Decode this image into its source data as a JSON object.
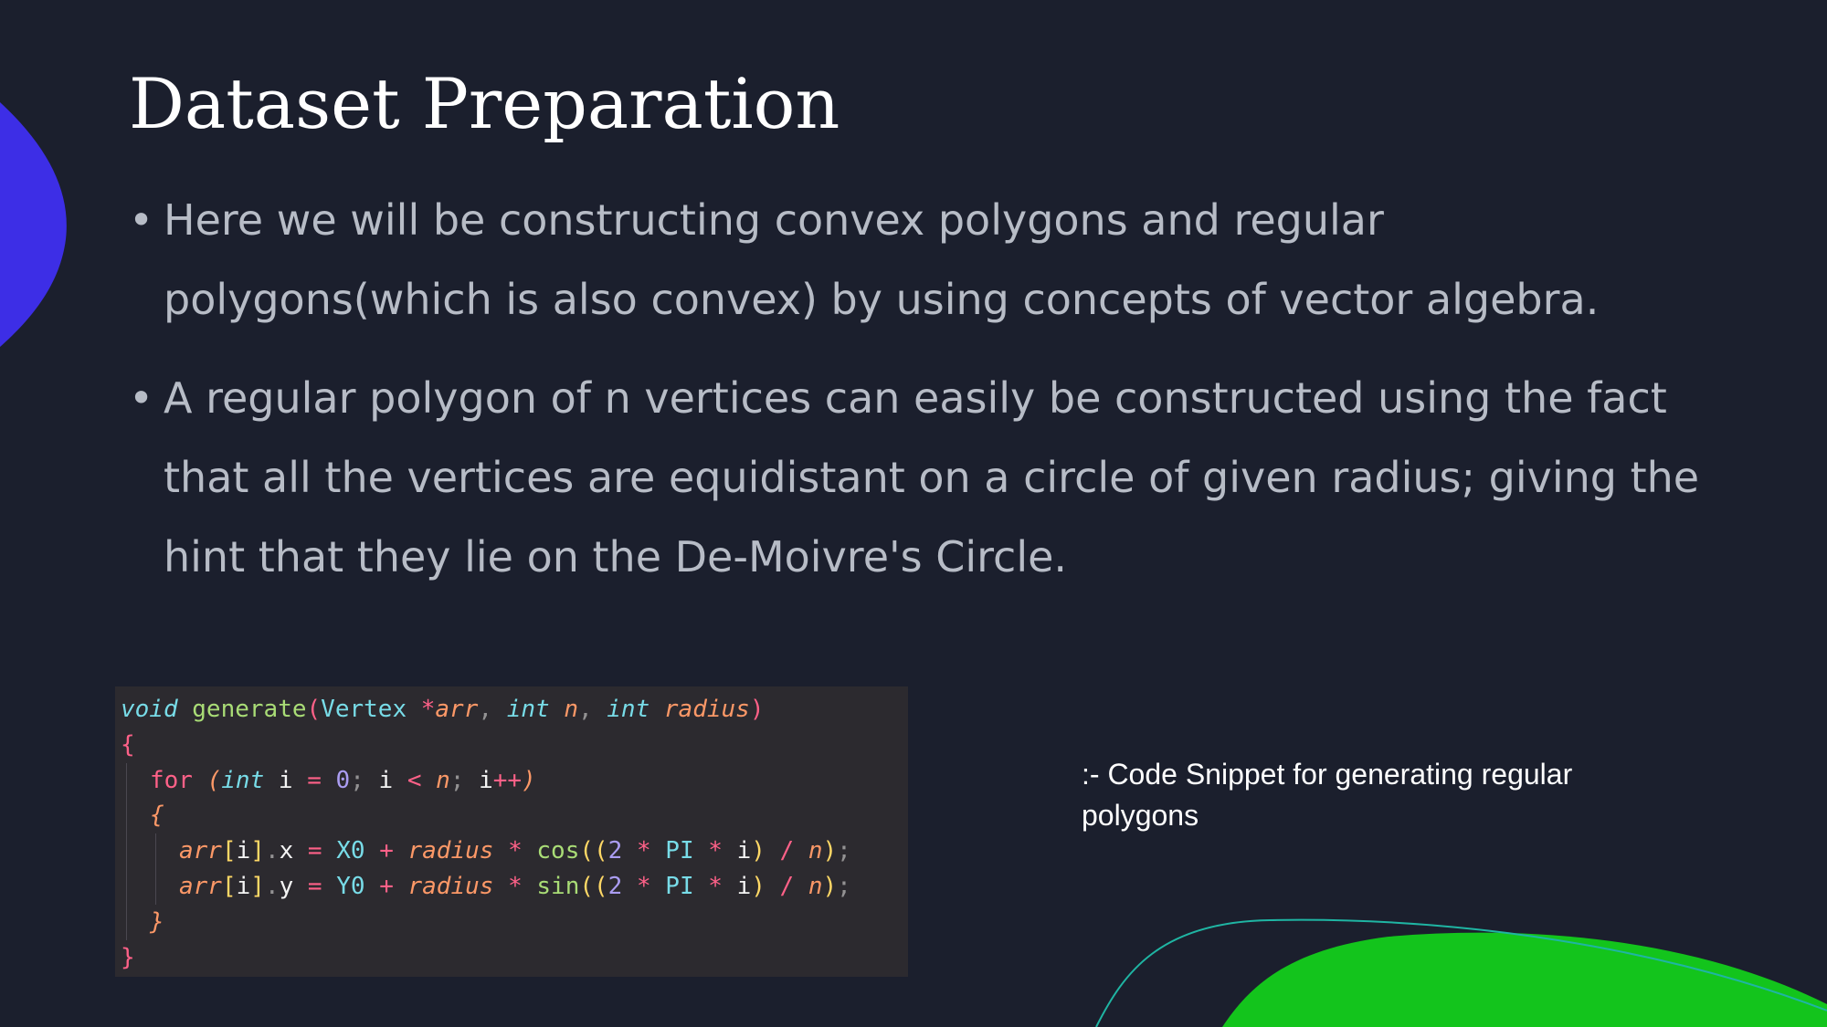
{
  "slide": {
    "title": "Dataset Preparation",
    "bullets": [
      "Here we will be constructing convex polygons and regular polygons(which is also convex) by using concepts of vector algebra.",
      "A regular polygon of n vertices can easily be constructed using the fact that all the vertices are equidistant on a circle of given radius; giving the hint that they lie on the De-Moivre's Circle."
    ],
    "bullet_marker": "•",
    "caption": ":- Code Snippet for generating regular polygons"
  },
  "code_snippet": {
    "lines": [
      {
        "indent": 0,
        "tokens": [
          {
            "t": "void",
            "c": "kw"
          },
          {
            "t": " ",
            "c": "pl"
          },
          {
            "t": "generate",
            "c": "fn"
          },
          {
            "t": "(",
            "c": "pn"
          },
          {
            "t": "Vertex",
            "c": "ty"
          },
          {
            "t": " ",
            "c": "pl"
          },
          {
            "t": "*",
            "c": "op"
          },
          {
            "t": "arr",
            "c": "pm"
          },
          {
            "t": ", ",
            "c": "dm"
          },
          {
            "t": "int",
            "c": "kw"
          },
          {
            "t": " ",
            "c": "pl"
          },
          {
            "t": "n",
            "c": "pm"
          },
          {
            "t": ", ",
            "c": "dm"
          },
          {
            "t": "int",
            "c": "kw"
          },
          {
            "t": " ",
            "c": "pl"
          },
          {
            "t": "radius",
            "c": "pm"
          },
          {
            "t": ")",
            "c": "pn"
          }
        ]
      },
      {
        "indent": 0,
        "tokens": [
          {
            "t": "{",
            "c": "ct"
          }
        ]
      },
      {
        "indent": 1,
        "tokens": [
          {
            "t": "for",
            "c": "ct"
          },
          {
            "t": " ",
            "c": "pl"
          },
          {
            "t": "(",
            "c": "pm"
          },
          {
            "t": "int",
            "c": "kw"
          },
          {
            "t": " ",
            "c": "pl"
          },
          {
            "t": "i",
            "c": "pl"
          },
          {
            "t": " ",
            "c": "pl"
          },
          {
            "t": "=",
            "c": "op"
          },
          {
            "t": " ",
            "c": "pl"
          },
          {
            "t": "0",
            "c": "nm"
          },
          {
            "t": "; ",
            "c": "dm"
          },
          {
            "t": "i",
            "c": "pl"
          },
          {
            "t": " ",
            "c": "pl"
          },
          {
            "t": "<",
            "c": "op"
          },
          {
            "t": " ",
            "c": "pl"
          },
          {
            "t": "n",
            "c": "pm"
          },
          {
            "t": "; ",
            "c": "dm"
          },
          {
            "t": "i",
            "c": "pl"
          },
          {
            "t": "++",
            "c": "op"
          },
          {
            "t": ")",
            "c": "pm"
          }
        ]
      },
      {
        "indent": 1,
        "tokens": [
          {
            "t": "{",
            "c": "pm"
          }
        ]
      },
      {
        "indent": 2,
        "tokens": [
          {
            "t": "arr",
            "c": "pm"
          },
          {
            "t": "[",
            "c": "br"
          },
          {
            "t": "i",
            "c": "pl"
          },
          {
            "t": "]",
            "c": "br"
          },
          {
            "t": ".",
            "c": "dm"
          },
          {
            "t": "x",
            "c": "pl"
          },
          {
            "t": " ",
            "c": "pl"
          },
          {
            "t": "=",
            "c": "op"
          },
          {
            "t": " ",
            "c": "pl"
          },
          {
            "t": "X0",
            "c": "cs"
          },
          {
            "t": " ",
            "c": "pl"
          },
          {
            "t": "+",
            "c": "op"
          },
          {
            "t": " ",
            "c": "pl"
          },
          {
            "t": "radius",
            "c": "pm"
          },
          {
            "t": " ",
            "c": "pl"
          },
          {
            "t": "*",
            "c": "op"
          },
          {
            "t": " ",
            "c": "pl"
          },
          {
            "t": "cos",
            "c": "fn"
          },
          {
            "t": "((",
            "c": "br"
          },
          {
            "t": "2",
            "c": "nm"
          },
          {
            "t": " ",
            "c": "pl"
          },
          {
            "t": "*",
            "c": "op"
          },
          {
            "t": " ",
            "c": "pl"
          },
          {
            "t": "PI",
            "c": "cs"
          },
          {
            "t": " ",
            "c": "pl"
          },
          {
            "t": "*",
            "c": "op"
          },
          {
            "t": " ",
            "c": "pl"
          },
          {
            "t": "i",
            "c": "pl"
          },
          {
            "t": ")",
            "c": "br"
          },
          {
            "t": " ",
            "c": "pl"
          },
          {
            "t": "/",
            "c": "op"
          },
          {
            "t": " ",
            "c": "pl"
          },
          {
            "t": "n",
            "c": "pm"
          },
          {
            "t": ")",
            "c": "br"
          },
          {
            "t": ";",
            "c": "dm"
          }
        ]
      },
      {
        "indent": 2,
        "tokens": [
          {
            "t": "arr",
            "c": "pm"
          },
          {
            "t": "[",
            "c": "br"
          },
          {
            "t": "i",
            "c": "pl"
          },
          {
            "t": "]",
            "c": "br"
          },
          {
            "t": ".",
            "c": "dm"
          },
          {
            "t": "y",
            "c": "pl"
          },
          {
            "t": " ",
            "c": "pl"
          },
          {
            "t": "=",
            "c": "op"
          },
          {
            "t": " ",
            "c": "pl"
          },
          {
            "t": "Y0",
            "c": "cs"
          },
          {
            "t": " ",
            "c": "pl"
          },
          {
            "t": "+",
            "c": "op"
          },
          {
            "t": " ",
            "c": "pl"
          },
          {
            "t": "radius",
            "c": "pm"
          },
          {
            "t": " ",
            "c": "pl"
          },
          {
            "t": "*",
            "c": "op"
          },
          {
            "t": " ",
            "c": "pl"
          },
          {
            "t": "sin",
            "c": "fn"
          },
          {
            "t": "((",
            "c": "br"
          },
          {
            "t": "2",
            "c": "nm"
          },
          {
            "t": " ",
            "c": "pl"
          },
          {
            "t": "*",
            "c": "op"
          },
          {
            "t": " ",
            "c": "pl"
          },
          {
            "t": "PI",
            "c": "cs"
          },
          {
            "t": " ",
            "c": "pl"
          },
          {
            "t": "*",
            "c": "op"
          },
          {
            "t": " ",
            "c": "pl"
          },
          {
            "t": "i",
            "c": "pl"
          },
          {
            "t": ")",
            "c": "br"
          },
          {
            "t": " ",
            "c": "pl"
          },
          {
            "t": "/",
            "c": "op"
          },
          {
            "t": " ",
            "c": "pl"
          },
          {
            "t": "n",
            "c": "pm"
          },
          {
            "t": ")",
            "c": "br"
          },
          {
            "t": ";",
            "c": "dm"
          }
        ]
      },
      {
        "indent": 1,
        "tokens": [
          {
            "t": "}",
            "c": "pm"
          }
        ]
      },
      {
        "indent": 0,
        "tokens": [
          {
            "t": "}",
            "c": "ct"
          }
        ]
      }
    ]
  },
  "colors": {
    "background": "#1b1f2d",
    "title_text": "#ffffff",
    "body_text": "#b7bcc6",
    "code_background": "#2c2a2f",
    "accent_blue": "#3d2ee6",
    "accent_green": "#13c41c",
    "accent_teal_line": "#1fb5a3"
  }
}
